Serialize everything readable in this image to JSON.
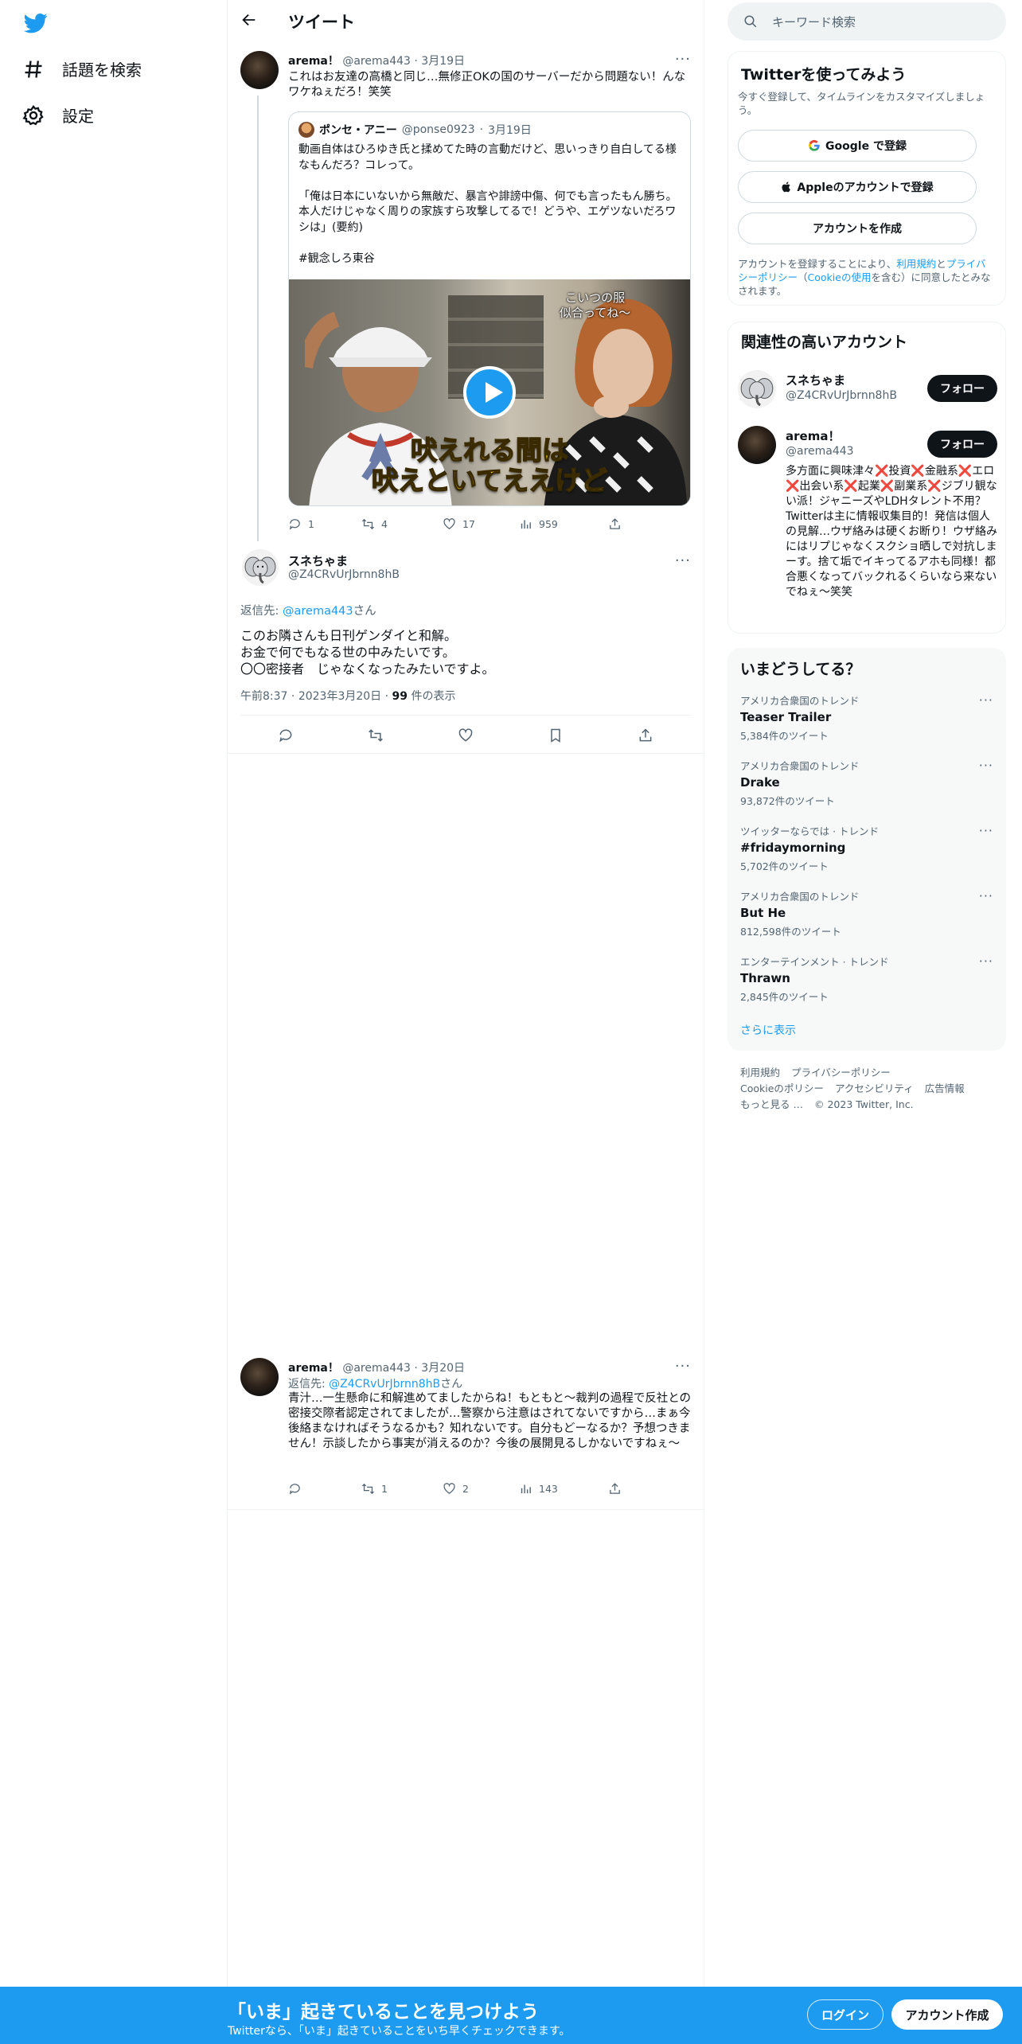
{
  "colors": {
    "brand": "#1d9bf0",
    "text": "#0f1419",
    "secondary": "#536471",
    "border": "#eff3f4"
  },
  "nav": {
    "logo_icon": "twitter-bird-icon",
    "explore": "話題を検索",
    "settings": "設定"
  },
  "header": {
    "title": "ツイート"
  },
  "tweet1": {
    "name": "arema！",
    "handle": "@arema443",
    "date": "3月19日",
    "text": "これはお友達の高橋と同じ…無修正OKの国のサーバーだから問題ない！んなワケねぇだろ！笑笑",
    "quote": {
      "name": "ポンセ・アニー",
      "handle": "@ponse0923",
      "date": "3月19日",
      "text": "動画自体はひろゆき氏と揉めてた時の言動だけど、思いっきり自白してる様なもんだろ？コレって。\n\n「俺は日本にいないから無敵だ、暴言や誹謗中傷、何でも言ったもん勝ち。本人だけじゃなく周りの家族すら攻撃してるで！どうや、エゲツないだろワシは」(要約)\n\n#観念しろ東谷",
      "video_caption_top": "こいつの服\n似合ってね〜",
      "video_caption_main": "吠えれる間は\n吠えといてええけど"
    },
    "stats": {
      "replies": "1",
      "retweets": "4",
      "likes": "17",
      "views": "959"
    }
  },
  "main_tweet": {
    "name": "スネちゃま",
    "handle": "@Z4CRvUrJbrnn8hB",
    "reply_to_prefix": "返信先: ",
    "reply_to_handle": "@arema443",
    "reply_to_suffix": "さん",
    "text": "このお隣さんも日刊ゲンダイと和解。\nお金で何でもなる世の中みたいです。\n〇〇密接者　じゃなくなったみたいですよ。",
    "time": "午前8:37",
    "date": "2023年3月20日",
    "views": "99",
    "views_label": " 件の表示"
  },
  "tweet3": {
    "name": "arema！",
    "handle": "@arema443",
    "date": "3月20日",
    "reply_to_prefix": "返信先: ",
    "reply_to_handle": "@Z4CRvUrJbrnn8hB",
    "reply_to_suffix": "さん",
    "text": "青汁…一生懸命に和解進めてましたからね！もともと〜裁判の過程で反社との密接交際者認定されてましたが…警察から注意はされてないですから…まぁ今後絡まなければそうなるかも？知れないです。自分もどーなるか？予想つきません！示談したから事実が消えるのか？今後の展開見るしかないですねぇ〜",
    "stats": {
      "replies": "",
      "retweets": "1",
      "likes": "2",
      "views": "143"
    }
  },
  "search": {
    "placeholder": "キーワード検索"
  },
  "signup": {
    "title": "Twitterを使ってみよう",
    "subtitle": "今すぐ登録して、タイムラインをカスタマイズしましょう。",
    "google": "Google で登録",
    "apple": "Appleのアカウントで登録",
    "create": "アカウントを作成",
    "legal_1": "アカウントを登録することにより、",
    "legal_terms": "利用規約",
    "legal_2": "と",
    "legal_privacy": "プライバシーポリシー",
    "legal_3": "（",
    "legal_cookie": "Cookieの使用",
    "legal_4": "を含む）に同意したとみなされます。"
  },
  "related": {
    "title": "関連性の高いアカウント",
    "follow_label": "フォロー",
    "accounts": [
      {
        "name": "スネちゃま",
        "handle": "@Z4CRvUrJbrnn8hB",
        "bio": ""
      },
      {
        "name": "arema！",
        "handle": "@arema443",
        "bio": "多方面に興味津々❌投資❌金融系❌エロ❌出会い系❌起業❌副業系❌ジブリ観ない派！ジャニーズやLDHタレント不用？Twitterは主に情報収集目的！発信は個人の見解…ウザ絡みは硬くお断り！ウザ絡みにはリプじゃなくスクショ晒しで対抗しまーす。捨て垢でイキってるアホも同様！都合悪くなってバックれるくらいなら来ないでねぇ〜笑笑"
      }
    ]
  },
  "trends": {
    "title": "いまどうしてる？",
    "items": [
      {
        "context": "アメリカ合衆国のトレンド",
        "title": "Teaser Trailer",
        "count": "5,384件のツイート"
      },
      {
        "context": "アメリカ合衆国のトレンド",
        "title": "Drake",
        "count": "93,872件のツイート"
      },
      {
        "context": "ツイッターならでは · トレンド",
        "title": "#fridaymorning",
        "count": "5,702件のツイート"
      },
      {
        "context": "アメリカ合衆国のトレンド",
        "title": "But He",
        "count": "812,598件のツイート"
      },
      {
        "context": "エンターテインメント · トレンド",
        "title": "Thrawn",
        "count": "2,845件のツイート"
      }
    ],
    "show_more": "さらに表示"
  },
  "footer": {
    "terms": "利用規約",
    "privacy": "プライバシーポリシー",
    "cookie": "Cookieのポリシー",
    "accessibility": "アクセシビリティ",
    "ads": "広告情報",
    "more": "もっと見る …",
    "copyright": "© 2023 Twitter, Inc."
  },
  "bottom_bar": {
    "title": "「いま」起きていることを見つけよう",
    "subtitle": "Twitterなら、「いま」起きていることをいち早くチェックできます。",
    "login": "ログイン",
    "signup": "アカウント作成"
  }
}
